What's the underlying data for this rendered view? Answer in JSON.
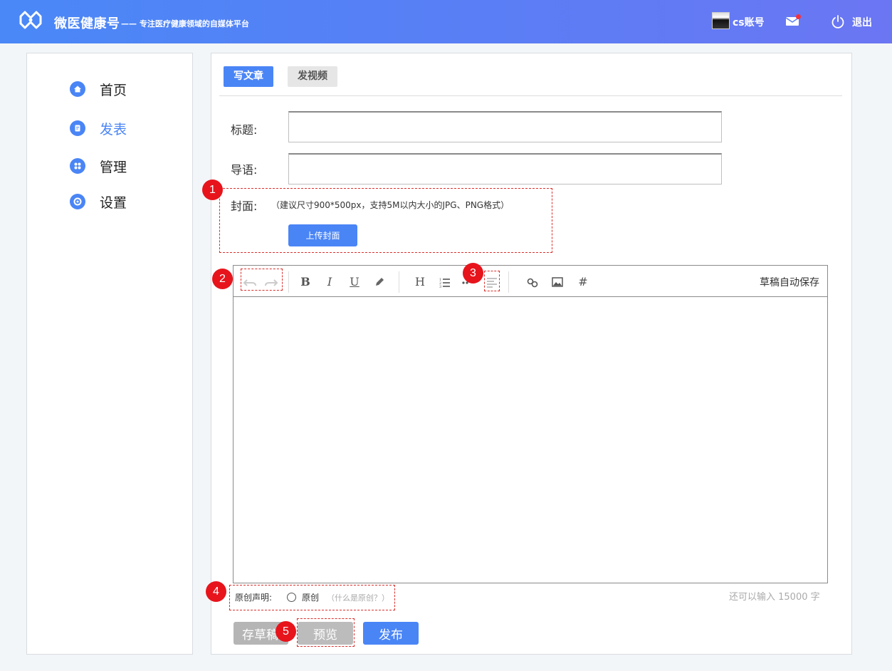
{
  "header": {
    "brand": "微医健康号",
    "tagline": "—— 专注医疗健康领域的自媒体平台",
    "account": "cs账号",
    "logout": "退出",
    "icons": [
      "logo-icon",
      "mail-icon",
      "power-icon"
    ]
  },
  "sidebar": {
    "items": [
      {
        "label": "首页",
        "icon": "home-icon"
      },
      {
        "label": "发表",
        "icon": "publish-icon"
      },
      {
        "label": "管理",
        "icon": "grid-icon"
      },
      {
        "label": "设置",
        "icon": "gear-icon"
      }
    ],
    "active": "发表"
  },
  "tabs": {
    "write": "写文章",
    "video": "发视频"
  },
  "form": {
    "title_label": "标题:",
    "title_value": "",
    "intro_label": "导语:",
    "intro_value": "",
    "cover_label": "封面:",
    "cover_hint": "（建议尺寸900*500px，支持5M以内大小的JPG、PNG格式）",
    "upload_button": "上传封面"
  },
  "editor": {
    "tools": [
      "undo-icon",
      "redo-icon",
      "bold-icon",
      "italic-icon",
      "underline-icon",
      "pen-icon",
      "heading-icon",
      "ordered-list-icon",
      "unordered-list-icon",
      "align-icon",
      "link-icon",
      "image-icon",
      "hashtag-icon"
    ],
    "bold": "B",
    "italic": "I",
    "underline": "U",
    "heading": "H",
    "hashtag": "#",
    "autosave": "草稿自动保存",
    "content": ""
  },
  "original": {
    "label": "原创声明:",
    "option": "原创",
    "help": "（什么是原创？）",
    "checked": false
  },
  "char_count": "还可以输入 15000 字",
  "actions": {
    "draft": "存草稿",
    "preview": "预览",
    "publish": "发布"
  },
  "annotations": [
    "1",
    "2",
    "3",
    "4",
    "5"
  ],
  "colors": {
    "accent": "#4a85f6",
    "annotation_red": "#e7141c",
    "header_gradient": [
      "#4a88f7",
      "#6b76f3"
    ]
  }
}
